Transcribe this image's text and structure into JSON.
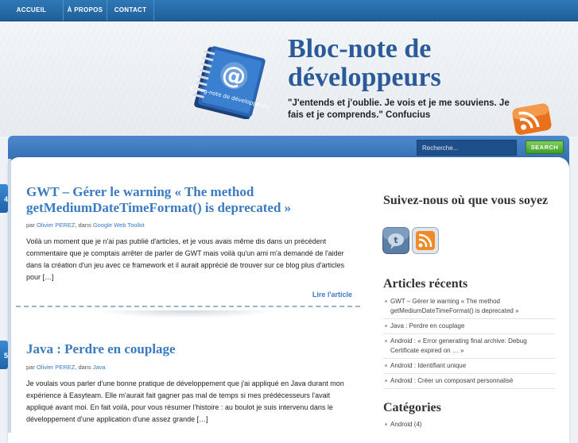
{
  "nav": {
    "items": [
      "ACCUEIL",
      "À PROPOS",
      "CONTACT"
    ]
  },
  "header": {
    "title_line1": "Bloc-note de",
    "title_line2": "développeurs",
    "tagline": "\"J'entends et j'oublie. Je vois et je me souviens. Je fais et je comprends.\" Confucius",
    "logo_text": "le blog-note de développeurs",
    "logo_symbol": "@"
  },
  "search": {
    "placeholder": "Recherche...",
    "button_label": "SEARCH"
  },
  "posts": [
    {
      "date_fragment": "4",
      "title": "GWT – Gérer le warning « The method getMediumDateTimeFormat() is deprecated »",
      "meta_prefix": "par",
      "author": "Olivier PEREZ",
      "meta_in": ", dans",
      "category": "Google Web Toolkit",
      "excerpt": "Voilà un moment que je n'ai pas publié d'articles, et je vous avais même dis dans un précédent commentaire que je comptais arrêter de parler de GWT mais voilà qu'un ami m'a demandé de l'aider dans la création d'un jeu avec ce framework et il aurait apprécié de trouver sur ce blog plus d'articles pour […]",
      "read_more": "Lire l'article"
    },
    {
      "date_fragment": "5",
      "title": "Java : Perdre en couplage",
      "meta_prefix": "par",
      "author": "Olivier PEREZ",
      "meta_in": ", dans",
      "category": "Java",
      "excerpt": "Je voulais vous parler d'une bonne pratique de développement que j'ai appliqué en Java durant mon expérience à Easyteam. Elle m'aurait fait gagner pas mal de temps si mes prédécesseurs l'avait appliqué avant moi. En fait voilà, pour vous résumer l'histoire : au boulot je suis intervenu dans le développement d'une application d'une assez grande […]"
    }
  ],
  "sidebar": {
    "follow_heading": "Suivez-nous où que vous soyez",
    "recent_heading": "Articles récents",
    "recent": [
      "GWT – Gérer le warning « The method getMediumDateTimeFormat() is deprecated »",
      "Java : Perdre en couplage",
      "Android : « Error generating final archive: Debug Certificate expired on … »",
      "Android : Identifiant unique",
      "Android : Créer un composant personnalisé"
    ],
    "categories_heading": "Catégories",
    "categories": [
      "Android (4)"
    ]
  },
  "colors": {
    "link": "#3a7ac2",
    "nav": "#2f79b7",
    "title": "#2a5a97",
    "search_button": "#5bb83f"
  }
}
